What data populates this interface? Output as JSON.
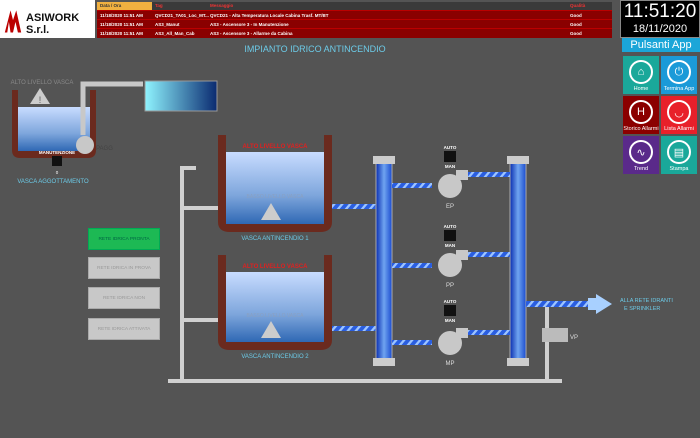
{
  "logo": {
    "text": "ASIWORK S.r.l."
  },
  "alarms": {
    "headers": [
      "Data / Ora",
      "Tag",
      "Messaggio",
      "Qualità"
    ],
    "rows": [
      {
        "time": "11/18/2020 11:51 AM",
        "tag": "QVCD21_TA01_Loc_MT...",
        "message": "QVCD21 - Alta Temperatura Locale Cabina Trasf. MT/BT",
        "quality": "Good"
      },
      {
        "time": "11/18/2020 11:51 AM",
        "tag": "AS3_Manut",
        "message": "AS3 - Ascensore 3 - In Manutenzione",
        "quality": "Good"
      },
      {
        "time": "11/18/2020 11:51 AM",
        "tag": "AS3_All_Man_Cab",
        "message": "AS3 - Ascensore 3 - Allarme da Cabina",
        "quality": "Good"
      }
    ]
  },
  "clock": {
    "time": "11:51:20",
    "date": "18/11/2020"
  },
  "apps": {
    "title": "Pulsanti App",
    "buttons": [
      {
        "label": "Home",
        "icon": "home-icon",
        "color": "#1aa89a"
      },
      {
        "label": "Termina App",
        "icon": "power-icon",
        "color": "#1b9ad8"
      },
      {
        "label": "Storico Allarmi",
        "icon": "alarm-history-icon",
        "color": "#8b0000"
      },
      {
        "label": "Lista Allarmi",
        "icon": "alarm-list-icon",
        "color": "#e8202a"
      },
      {
        "label": "Trend",
        "icon": "trend-icon",
        "color": "#5a2a8a"
      },
      {
        "label": "Stampa",
        "icon": "printer-icon",
        "color": "#1aa89a"
      }
    ]
  },
  "page": {
    "title": "IMPIANTO IDRICO ANTINCENDIO"
  },
  "sump": {
    "alarm": "ALTO LIVELLO VASCA",
    "label": "VASCA AGGOTTAMENTO",
    "pump": "PAGG",
    "switch_label": "MANUTENZIONE",
    "switch_value": "0"
  },
  "tanks": [
    {
      "label": "VASCA ANTINCENDIO 1",
      "high_alarm": "ALTO LIVELLO VASCA",
      "low_alarm": "BASSO LIVELLO VASCA"
    },
    {
      "label": "VASCA ANTINCENDIO 2",
      "high_alarm": "ALTO LIVELLO VASCA",
      "low_alarm": "BASSO LIVELLO VASCA"
    }
  ],
  "status_buttons": [
    {
      "label": "RETE IDRICA PRONTA",
      "active": true
    },
    {
      "label": "RETE IDRICA IN PROVA",
      "active": false
    },
    {
      "label": "RETE IDRICA NON DISPONIBILE",
      "active": false
    },
    {
      "label": "RETE IDRICA ATTIVATA",
      "active": false
    }
  ],
  "pumps": [
    {
      "name": "EP",
      "auto": "AUTO",
      "man": "MAN"
    },
    {
      "name": "PP",
      "auto": "AUTO",
      "man": "MAN"
    },
    {
      "name": "MP",
      "auto": "AUTO",
      "man": "MAN"
    }
  ],
  "valve": {
    "name": "VP"
  },
  "outlet": {
    "line1": "ALLA RETE IDRANTI",
    "line2": "E SPRINKLER"
  },
  "colors": {
    "background": "#545454",
    "tank_wall": "#6b2a1e",
    "water": "#3d78c0",
    "accent": "#6ccbe8",
    "alarm_red": "#e02020"
  }
}
